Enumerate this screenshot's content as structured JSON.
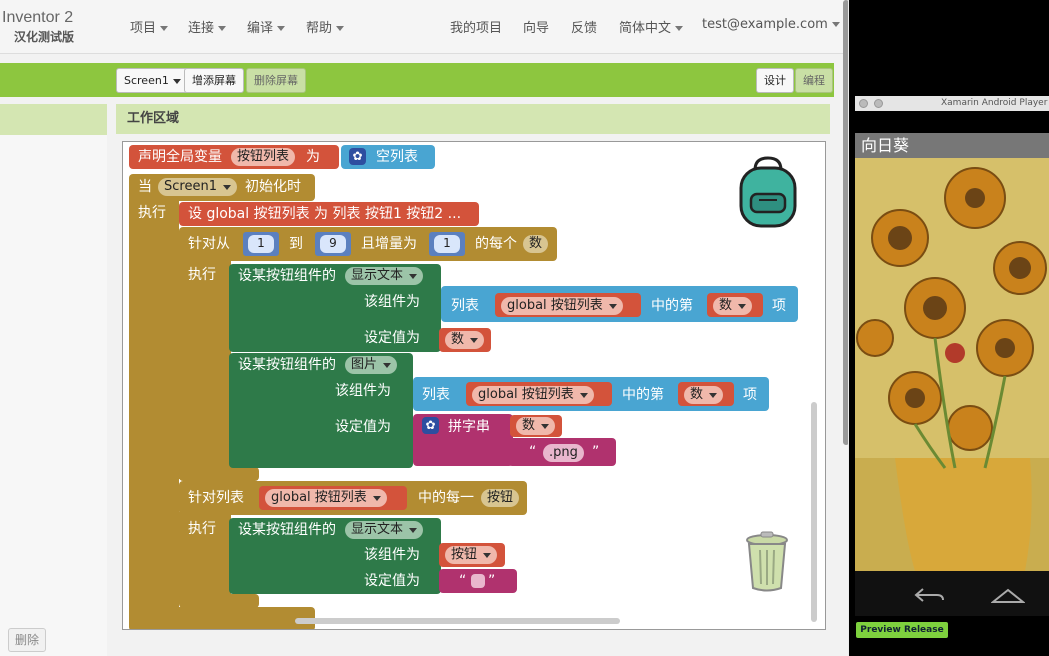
{
  "header": {
    "logo_line1": "Inventor 2",
    "logo_line2": "汉化测试版",
    "menus": [
      "项目",
      "连接",
      "编译",
      "帮助"
    ],
    "right_links": [
      "我的项目",
      "向导",
      "反馈"
    ],
    "language": "简体中文",
    "account": "test@example.com"
  },
  "toolbar": {
    "screen_select": "Screen1",
    "add_screen": "增添屏幕",
    "remove_screen": "删除屏幕",
    "designer": "设计",
    "blocks": "编程"
  },
  "left_panel": {
    "delete_button": "删除"
  },
  "workspace": {
    "title": "工作区域"
  },
  "blocks": {
    "global_decl": {
      "prefix": "声明全局变量",
      "name": "按钮列表",
      "as": "为",
      "empty_list": "空列表"
    },
    "event": {
      "when": "当",
      "component": "Screen1",
      "event": "初始化时",
      "do": "执行"
    },
    "set_global": "设 global 按钮列表 为 列表 按钮1 按钮2 ...",
    "for_range": {
      "label": "针对从",
      "from": "1",
      "to_label": "到",
      "to": "9",
      "step_label": "且增量为",
      "step": "1",
      "each": "的每个",
      "var": "数",
      "do": "执行"
    },
    "set_text": {
      "label": "设某按钮组件的",
      "prop": "显示文本",
      "component_label": "该组件为",
      "value_label": "设定值为"
    },
    "list_select": {
      "list": "列表",
      "global": "global 按钮列表",
      "index_label": "中的第",
      "index": "数",
      "item": "项"
    },
    "value_num": "数",
    "set_image": {
      "label": "设某按钮组件的",
      "prop": "图片",
      "component_label": "该组件为",
      "value_label": "设定值为"
    },
    "join": {
      "label": "拼字串",
      "num": "数",
      "text": ".png"
    },
    "for_list": {
      "label": "针对列表",
      "global": "global 按钮列表",
      "each": "中的每一",
      "var": "按钮",
      "do": "执行"
    },
    "set_text2": {
      "label": "设某按钮组件的",
      "prop": "显示文本",
      "component_label": "该组件为",
      "component": "按钮",
      "value_label": "设定值为"
    }
  },
  "emulator": {
    "window_title": "Xamarin Android Player - [",
    "app_title": "向日葵",
    "preview_button": "Preview Release"
  }
}
